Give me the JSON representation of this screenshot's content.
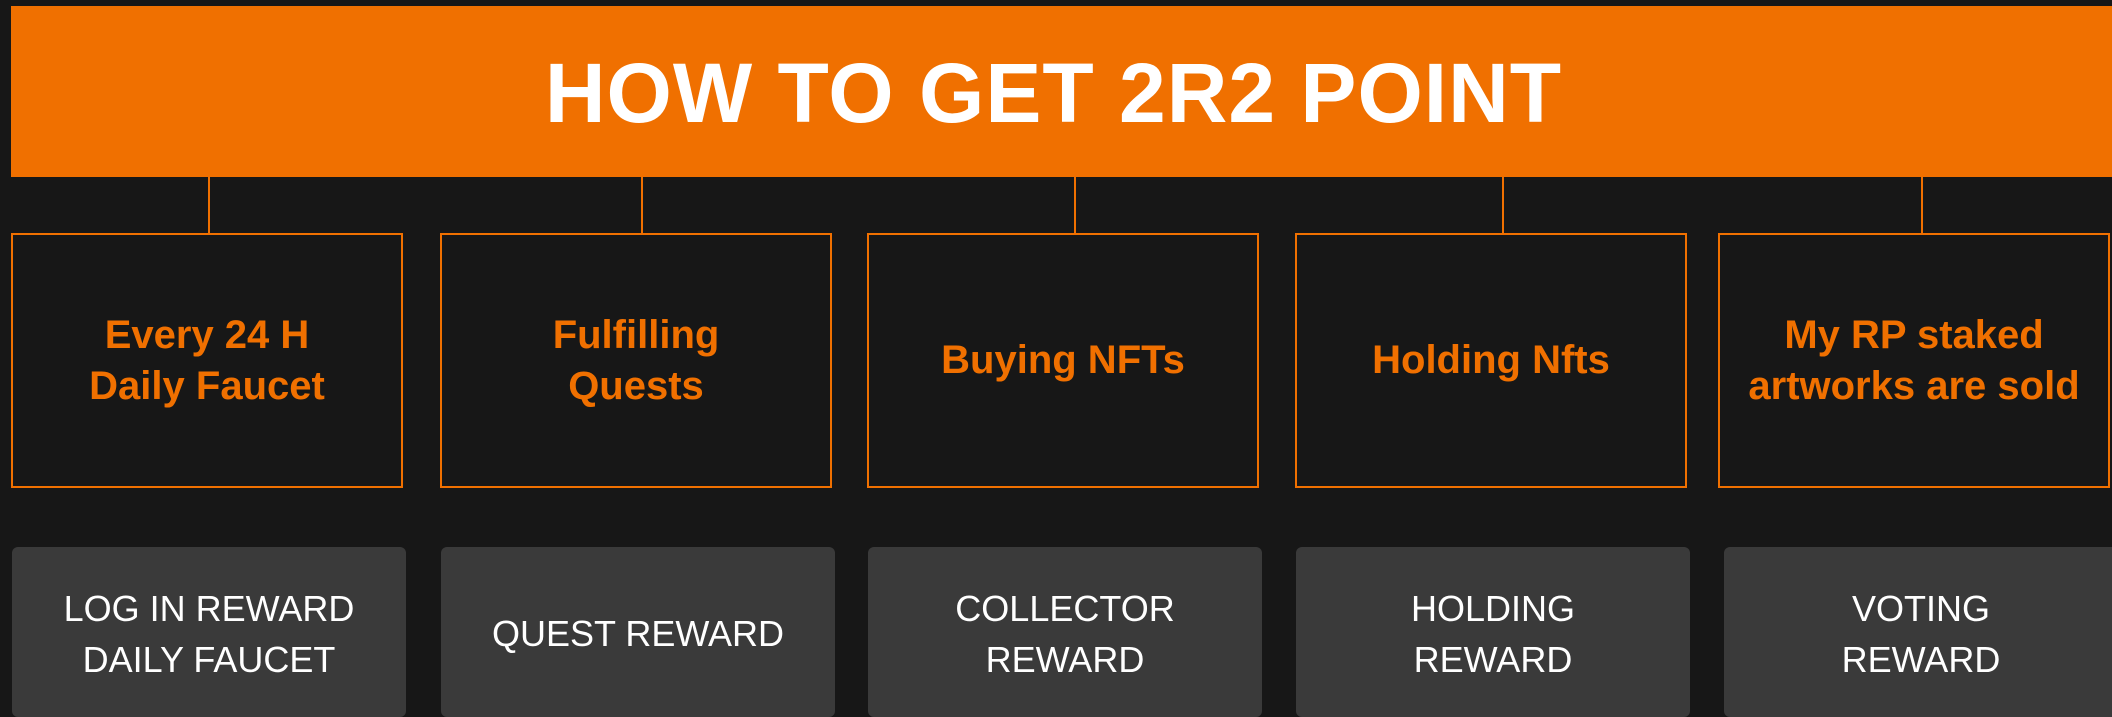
{
  "title": "HOW TO GET 2R2 POINT",
  "colors": {
    "accent": "#f07000",
    "background": "#171717",
    "reward_box": "#3a3a3a",
    "reward_text": "#ffffff"
  },
  "methods": [
    {
      "label": "Every  24 H\nDaily Faucet",
      "reward": "LOG IN REWARD\nDAILY FAUCET"
    },
    {
      "label": "Fulfilling\nQuests",
      "reward": "QUEST REWARD"
    },
    {
      "label": "Buying NFTs",
      "reward": "COLLECTOR\nREWARD"
    },
    {
      "label": "Holding Nfts",
      "reward": "HOLDING\nREWARD"
    },
    {
      "label": "My RP staked\nartworks are sold",
      "reward": "VOTING\nREWARD"
    }
  ]
}
